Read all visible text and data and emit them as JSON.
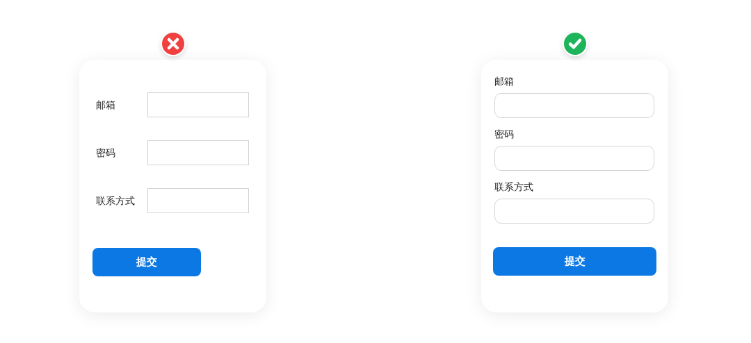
{
  "panels": [
    {
      "kind": "wrong",
      "fields": [
        {
          "label": "邮箱"
        },
        {
          "label": "密码"
        },
        {
          "label": "联系方式"
        }
      ],
      "button": "提交"
    },
    {
      "kind": "right",
      "fields": [
        {
          "label": "邮箱"
        },
        {
          "label": "密码"
        },
        {
          "label": "联系方式"
        }
      ],
      "button": "提交"
    }
  ]
}
